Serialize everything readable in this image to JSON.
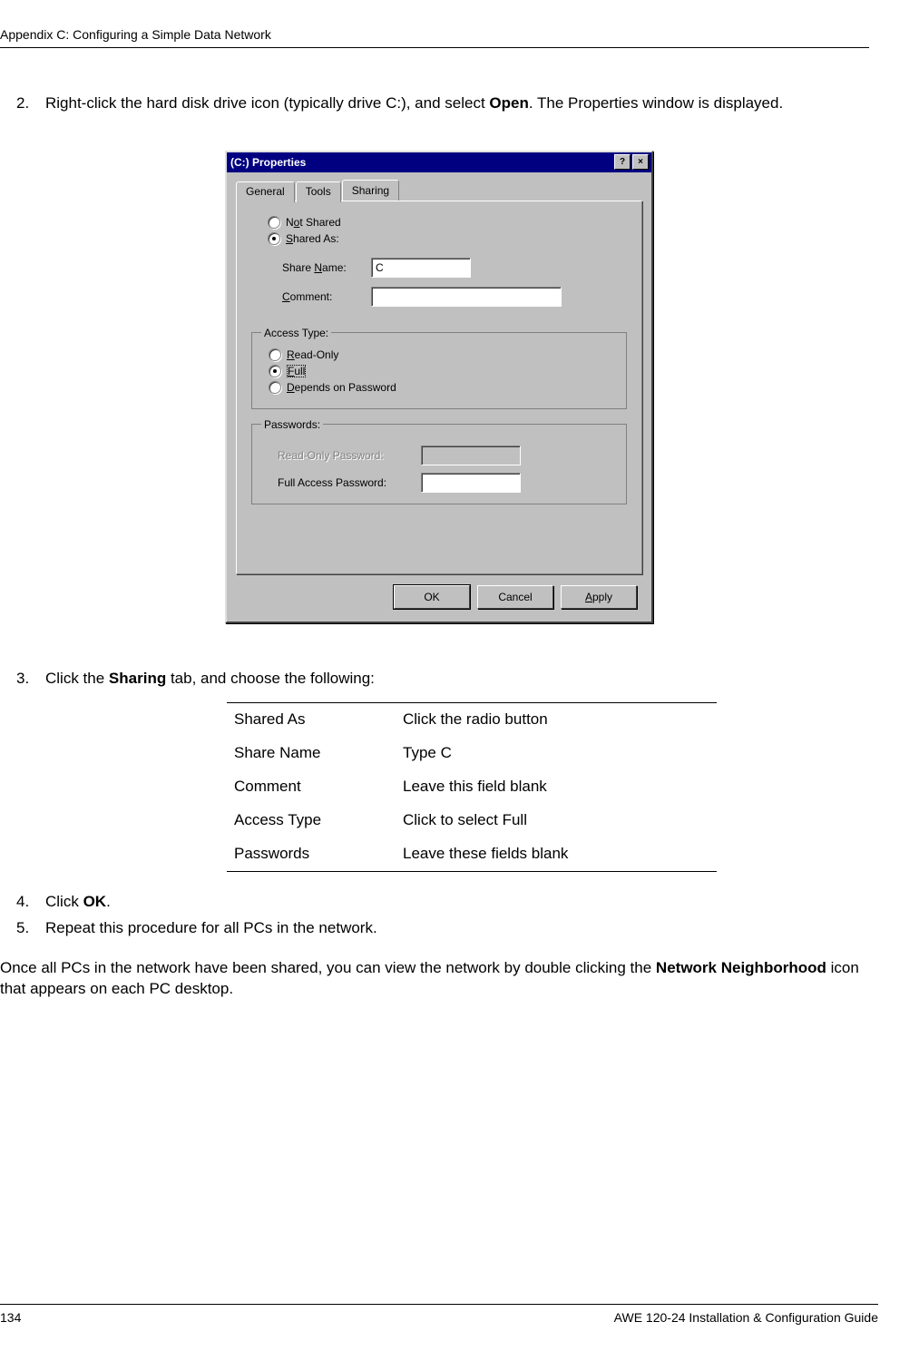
{
  "header": "Appendix C: Configuring a Simple Data Network",
  "steps": {
    "s2_num": "2.",
    "s2_a": "Right-click the hard disk drive icon (typically drive C:), and select ",
    "s2_b": "Open",
    "s2_c": ". The Properties window is displayed.",
    "s3_num": "3.",
    "s3_a": "Click the ",
    "s3_b": "Sharing",
    "s3_c": " tab, and choose the following:",
    "s4_num": "4.",
    "s4_a": "Click ",
    "s4_b": "OK",
    "s4_c": ".",
    "s5_num": "5.",
    "s5_text": "Repeat this procedure for all PCs in the network."
  },
  "dialog": {
    "title": "(C:) Properties",
    "help_glyph": "?",
    "close_glyph": "×",
    "tabs": {
      "general": "General",
      "tools": "Tools",
      "sharing": "Sharing"
    },
    "radios": {
      "not_shared_pre": "N",
      "not_shared_u": "o",
      "not_shared_post": "t Shared",
      "shared_as_u": "S",
      "shared_as_post": "hared As:"
    },
    "share_name_label_pre": "Share ",
    "share_name_label_u": "N",
    "share_name_label_post": "ame:",
    "share_name_value": "C",
    "comment_label_u": "C",
    "comment_label_post": "omment:",
    "comment_value": "",
    "access_legend": "Access Type:",
    "access_readonly_u": "R",
    "access_readonly_post": "ead-Only",
    "access_full_u": "F",
    "access_full_post": "ull",
    "access_depends_u": "D",
    "access_depends_post": "epends on Password",
    "pw_legend": "Passwords:",
    "pw_readonly_label": "Read-Only Password:",
    "pw_full_label_pre": "Full ",
    "pw_full_label_post": "Access Password:",
    "buttons": {
      "ok": "OK",
      "cancel": "Cancel",
      "apply_u": "A",
      "apply_post": "pply"
    }
  },
  "table": {
    "r1a": "Shared As",
    "r1b": "Click the radio button",
    "r2a": "Share Name",
    "r2b": "Type C",
    "r3a": "Comment",
    "r3b": "Leave this field blank",
    "r4a": "Access Type",
    "r4b": "Click to select Full",
    "r5a": "Passwords",
    "r5b": "Leave these fields blank"
  },
  "post": {
    "a": "Once all PCs in the network have been shared, you can view the network by double clicking the ",
    "b": "Network Neighborhood",
    "c": " icon that appears on each PC desktop."
  },
  "footer": {
    "page": "134",
    "guide": "AWE 120-24 Installation & Configuration Guide"
  }
}
